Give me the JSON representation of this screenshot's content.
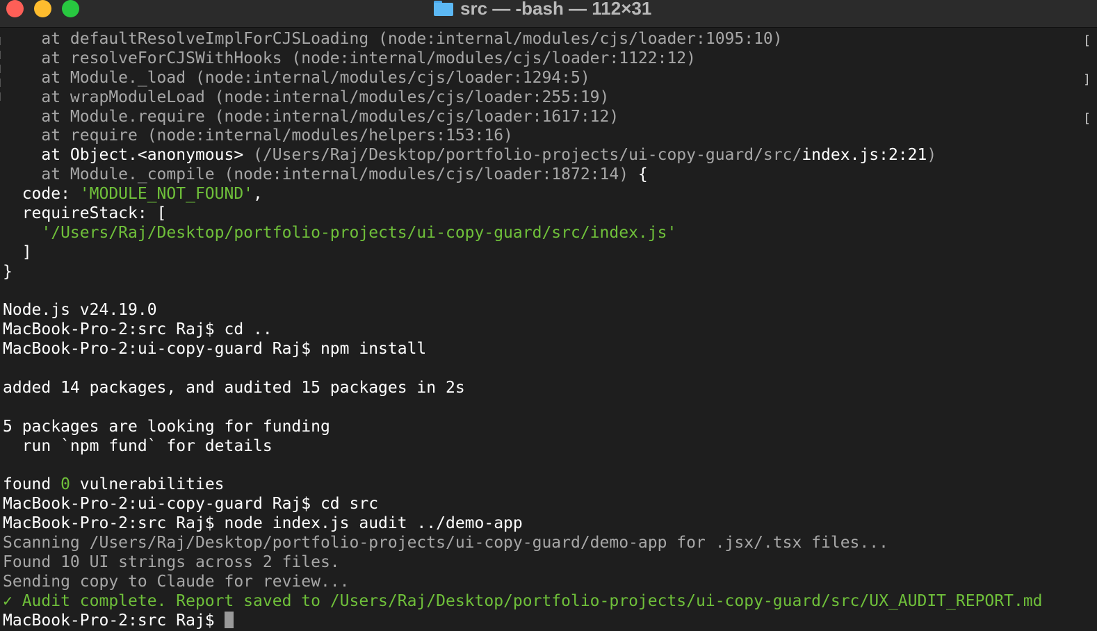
{
  "window": {
    "title": "src — -bash — 112×31"
  },
  "terminal": {
    "lines": [
      {
        "segments": [
          {
            "text": "    at defaultResolveImplForCJSLoading (node:internal/modules/cjs/loader:1095:10)",
            "style": "dim"
          }
        ]
      },
      {
        "segments": [
          {
            "text": "    at resolveForCJSWithHooks (node:internal/modules/cjs/loader:1122:12)",
            "style": "dim"
          }
        ]
      },
      {
        "segments": [
          {
            "text": "    at Module._load (node:internal/modules/cjs/loader:1294:5)",
            "style": "dim"
          }
        ]
      },
      {
        "segments": [
          {
            "text": "    at wrapModuleLoad (node:internal/modules/cjs/loader:255:19)",
            "style": "dim"
          }
        ]
      },
      {
        "segments": [
          {
            "text": "    at Module.require (node:internal/modules/cjs/loader:1617:12)",
            "style": "dim"
          }
        ]
      },
      {
        "segments": [
          {
            "text": "    at require (node:internal/modules/helpers:153:16)",
            "style": "dim"
          }
        ]
      },
      {
        "segments": [
          {
            "text": "    at Object.<anonymous> ",
            "style": "bright"
          },
          {
            "text": "(/Users/Raj/Desktop/portfolio-projects/ui-copy-guard/src/",
            "style": "dim"
          },
          {
            "text": "index.js:2:21",
            "style": "bright"
          },
          {
            "text": ")",
            "style": "dim"
          }
        ]
      },
      {
        "segments": [
          {
            "text": "    at Module._compile (node:internal/modules/cjs/loader:1872:14) ",
            "style": "dim"
          },
          {
            "text": "{",
            "style": "bright"
          }
        ]
      },
      {
        "segments": [
          {
            "text": "  code: ",
            "style": "bright"
          },
          {
            "text": "'MODULE_NOT_FOUND'",
            "style": "str"
          },
          {
            "text": ",",
            "style": "bright"
          }
        ]
      },
      {
        "segments": [
          {
            "text": "  requireStack: [",
            "style": "bright"
          }
        ]
      },
      {
        "segments": [
          {
            "text": "    '/Users/Raj/Desktop/portfolio-projects/ui-copy-guard/src/index.js'",
            "style": "str"
          }
        ]
      },
      {
        "segments": [
          {
            "text": "  ]",
            "style": "bright"
          }
        ]
      },
      {
        "segments": [
          {
            "text": "}",
            "style": "bright"
          }
        ]
      },
      {
        "segments": [
          {
            "text": "",
            "style": "bright"
          }
        ]
      },
      {
        "segments": [
          {
            "text": "Node.js v24.19.0",
            "style": "bright"
          }
        ]
      },
      {
        "segments": [
          {
            "text": "MacBook-Pro-2:src Raj$ cd ..",
            "style": "bright"
          }
        ]
      },
      {
        "segments": [
          {
            "text": "MacBook-Pro-2:ui-copy-guard Raj$ npm install",
            "style": "bright"
          }
        ]
      },
      {
        "segments": [
          {
            "text": "",
            "style": "bright"
          }
        ]
      },
      {
        "segments": [
          {
            "text": "added 14 packages, and audited 15 packages in 2s",
            "style": "bright"
          }
        ]
      },
      {
        "segments": [
          {
            "text": "",
            "style": "bright"
          }
        ]
      },
      {
        "segments": [
          {
            "text": "5 packages are looking for funding",
            "style": "bright"
          }
        ]
      },
      {
        "segments": [
          {
            "text": "  run `npm fund` for details",
            "style": "bright"
          }
        ]
      },
      {
        "segments": [
          {
            "text": "",
            "style": "bright"
          }
        ]
      },
      {
        "segments": [
          {
            "text": "found ",
            "style": "bright"
          },
          {
            "text": "0",
            "style": "str"
          },
          {
            "text": " vulnerabilities",
            "style": "bright"
          }
        ]
      },
      {
        "segments": [
          {
            "text": "MacBook-Pro-2:ui-copy-guard Raj$ cd src",
            "style": "bright"
          }
        ]
      },
      {
        "segments": [
          {
            "text": "MacBook-Pro-2:src Raj$ node index.js audit ../demo-app",
            "style": "bright"
          }
        ]
      },
      {
        "segments": [
          {
            "text": "Scanning /Users/Raj/Desktop/portfolio-projects/ui-copy-guard/demo-app for .jsx/.tsx files...",
            "style": "dim"
          }
        ]
      },
      {
        "segments": [
          {
            "text": "Found 10 UI strings across 2 files.",
            "style": "dim"
          }
        ]
      },
      {
        "segments": [
          {
            "text": "Sending copy to Claude for review...",
            "style": "dim"
          }
        ]
      },
      {
        "segments": [
          {
            "text": "✓ Audit complete. Report saved to /Users/Raj/Desktop/portfolio-projects/ui-copy-guard/src/UX_AUDIT_REPORT.md",
            "style": "str"
          }
        ]
      }
    ],
    "prompt": "MacBook-Pro-2:src Raj$ ",
    "edge_marks": [
      "[",
      "]",
      "[",
      "[",
      "["
    ]
  },
  "colors": {
    "background": "#1e1e1e",
    "text": "#ffffff",
    "dim_text": "#a7a7a7",
    "string_green": "#6fc03a",
    "close": "#fe5f57",
    "minimize": "#febc2e",
    "maximize": "#28c840"
  }
}
